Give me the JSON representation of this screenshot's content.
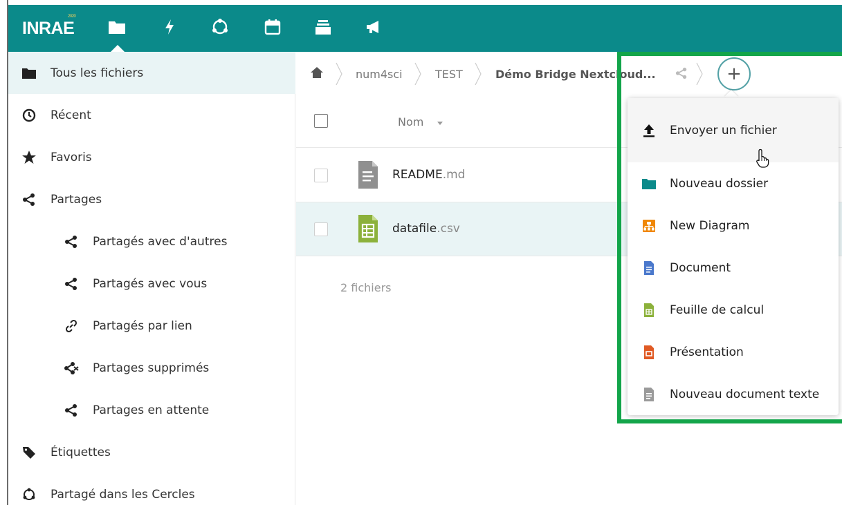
{
  "header": {
    "logo": "INRAE",
    "logo_sup": "2020",
    "apps": [
      "folder-icon",
      "activity-icon",
      "circles-icon",
      "calendar-icon",
      "deck-icon",
      "announcements-icon"
    ]
  },
  "sidebar": {
    "items": [
      {
        "label": "Tous les fichiers",
        "icon": "folder-icon"
      },
      {
        "label": "Récent",
        "icon": "clock-icon"
      },
      {
        "label": "Favoris",
        "icon": "star-icon"
      },
      {
        "label": "Partages",
        "icon": "share-icon"
      },
      {
        "label": "Partagés avec d'autres",
        "icon": "share-icon"
      },
      {
        "label": "Partagés avec vous",
        "icon": "share-icon"
      },
      {
        "label": "Partagés par lien",
        "icon": "link-icon"
      },
      {
        "label": "Partages supprimés",
        "icon": "share-deleted-icon"
      },
      {
        "label": "Partages en attente",
        "icon": "share-icon"
      },
      {
        "label": "Étiquettes",
        "icon": "tag-icon"
      },
      {
        "label": "Partagé dans les Cercles",
        "icon": "circles-icon"
      }
    ]
  },
  "breadcrumb": {
    "items": [
      "num4sci",
      "TEST",
      "Démo Bridge Nextcloud..."
    ],
    "add_label": "+"
  },
  "file_list": {
    "column_name": "Nom",
    "files": [
      {
        "name": "README",
        "ext": ".md",
        "icon": "text-file-icon"
      },
      {
        "name": "datafile",
        "ext": ".csv",
        "icon": "spreadsheet-file-icon"
      }
    ],
    "count_label": "2 fichiers"
  },
  "new_menu": {
    "items": [
      {
        "label": "Envoyer un fichier",
        "icon": "upload-icon"
      },
      {
        "label": "Nouveau dossier",
        "icon": "folder-icon"
      },
      {
        "label": "New Diagram",
        "icon": "diagram-icon"
      },
      {
        "label": "Document",
        "icon": "document-icon"
      },
      {
        "label": "Feuille de calcul",
        "icon": "spreadsheet-icon"
      },
      {
        "label": "Présentation",
        "icon": "presentation-icon"
      },
      {
        "label": "Nouveau document texte",
        "icon": "text-document-icon"
      }
    ]
  },
  "colors": {
    "header": "#0b8a8a",
    "active_bg": "#e9f4f5",
    "highlight": "#13a54a"
  }
}
